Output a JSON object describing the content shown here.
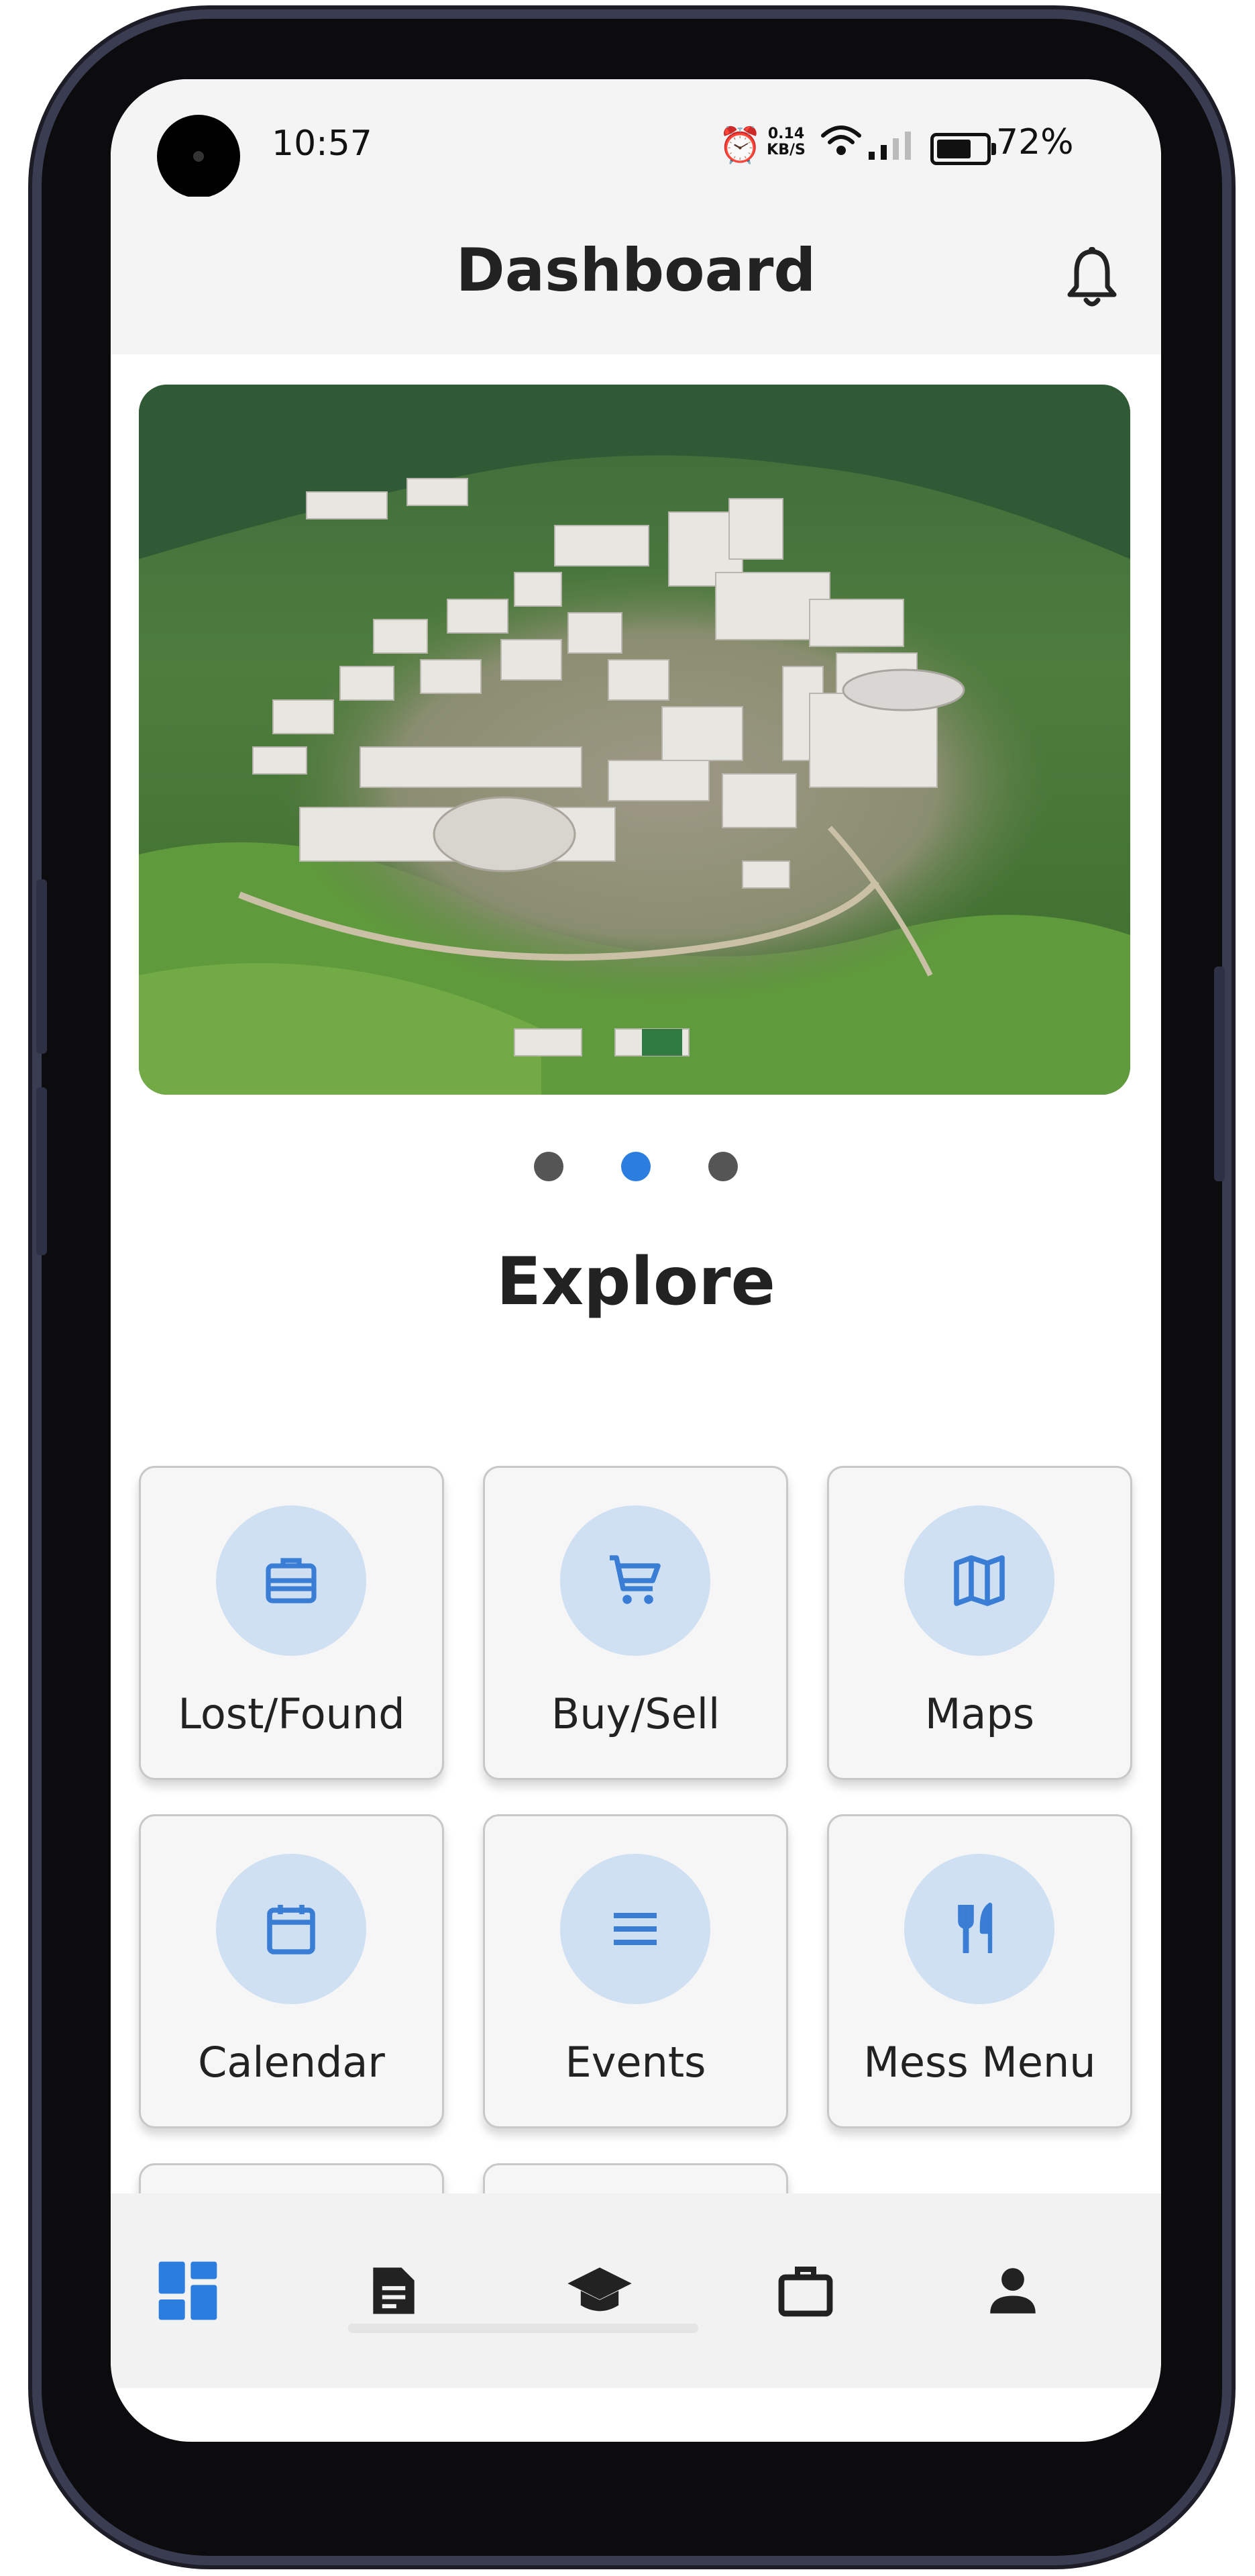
{
  "status_bar": {
    "time": "10:57",
    "net_speed_value": "0.14",
    "net_speed_unit": "KB/S",
    "battery_percent": "72%",
    "battery_level": 0.72,
    "icons": [
      "alarm-icon",
      "wifi-icon",
      "signal-icon",
      "battery-icon"
    ]
  },
  "header": {
    "title": "Dashboard",
    "notification_icon": "bell-icon"
  },
  "carousel": {
    "image_description": "aerial campus photo",
    "slides": 3,
    "active_index": 1
  },
  "explore": {
    "title": "Explore",
    "tiles": [
      {
        "label": "Lost/Found",
        "icon": "briefcase-icon"
      },
      {
        "label": "Buy/Sell",
        "icon": "cart-icon"
      },
      {
        "label": "Maps",
        "icon": "map-icon"
      },
      {
        "label": "Calendar",
        "icon": "calendar-icon"
      },
      {
        "label": "Events",
        "icon": "list-icon"
      },
      {
        "label": "Mess Menu",
        "icon": "restaurant-icon"
      },
      {
        "label": "",
        "icon": "cup-icon"
      },
      {
        "label": "",
        "icon": "link-icon"
      }
    ]
  },
  "bottom_nav": {
    "items": [
      {
        "icon": "dashboard-icon",
        "active": true
      },
      {
        "icon": "document-icon",
        "active": false
      },
      {
        "icon": "graduation-cap-icon",
        "active": false
      },
      {
        "icon": "briefcase-icon",
        "active": false
      },
      {
        "icon": "person-icon",
        "active": false
      }
    ]
  },
  "colors": {
    "accent": "#2b7de0",
    "icon_circle": "#cfe0f3",
    "icon_blue": "#3a7dd4"
  }
}
